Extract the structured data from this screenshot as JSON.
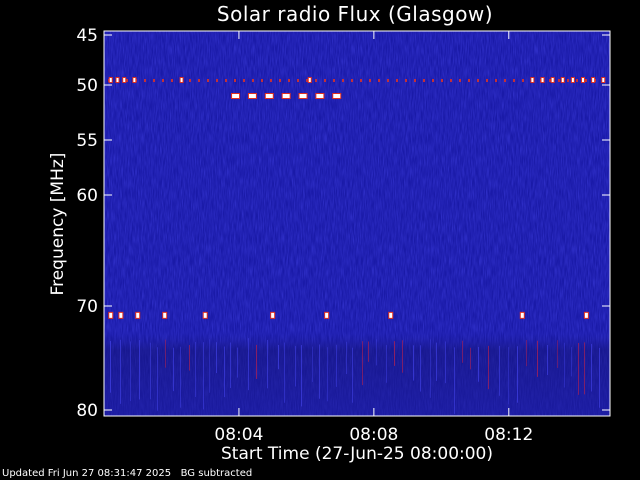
{
  "chart_data": {
    "type": "heatmap",
    "title": "Solar radio Flux (Glasgow)",
    "xlabel": "Start Time (27-Jun-25 08:00:00)",
    "ylabel": "Frequency [MHz]",
    "x_tick_labels": [
      "08:04",
      "08:08",
      "08:12"
    ],
    "x_ticks_minutes": [
      4,
      8,
      12
    ],
    "xlim_minutes": [
      0,
      15
    ],
    "y_tick_labels": [
      "45",
      "50",
      "55",
      "60",
      "70",
      "80"
    ],
    "y_ticks_mhz": [
      45,
      50,
      55,
      60,
      70,
      80
    ],
    "ylim_mhz": [
      45,
      80
    ],
    "y_scale": "nonlinear",
    "background_color": "#1a1aa8",
    "interference": {
      "band_50mhz_minutes": [
        0.2,
        0.4,
        0.6,
        0.9,
        2.3,
        6.1,
        12.7,
        13.0,
        13.3,
        13.6,
        13.9,
        14.2,
        14.5,
        14.8
      ],
      "band_51mhz_minutes": [
        3.9,
        4.4,
        4.9,
        5.4,
        5.9,
        6.4,
        6.9
      ],
      "band_71mhz_minutes": [
        0.2,
        0.5,
        1.0,
        1.8,
        3.0,
        5.0,
        6.6,
        8.5,
        12.4,
        14.3
      ]
    }
  },
  "footer": "Updated Fri Jun 27 08:31:47 2025   BG subtracted"
}
